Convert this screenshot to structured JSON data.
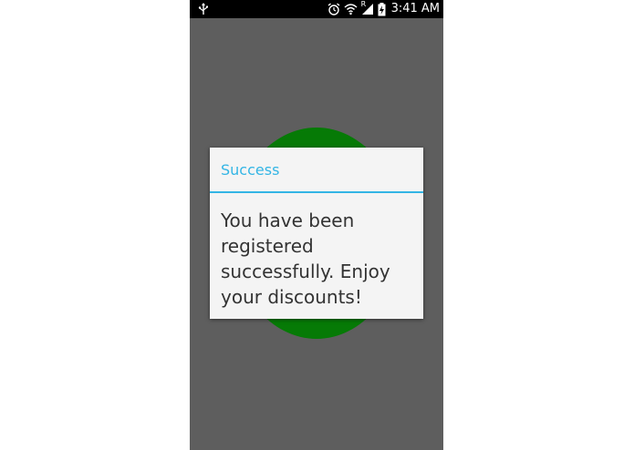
{
  "status_bar": {
    "time": "3:41 AM",
    "icons": [
      "usb-icon",
      "alarm-icon",
      "wifi-icon",
      "signal-icon",
      "battery-charging-icon"
    ],
    "roaming_label": "R"
  },
  "dialog": {
    "title": "Success",
    "message": "You have been registered successfully. Enjoy your discounts!"
  },
  "colors": {
    "accent": "#33b5e5",
    "background": "#5e5e5e",
    "circle": "#067a06",
    "dialog_bg": "#f4f4f4"
  }
}
